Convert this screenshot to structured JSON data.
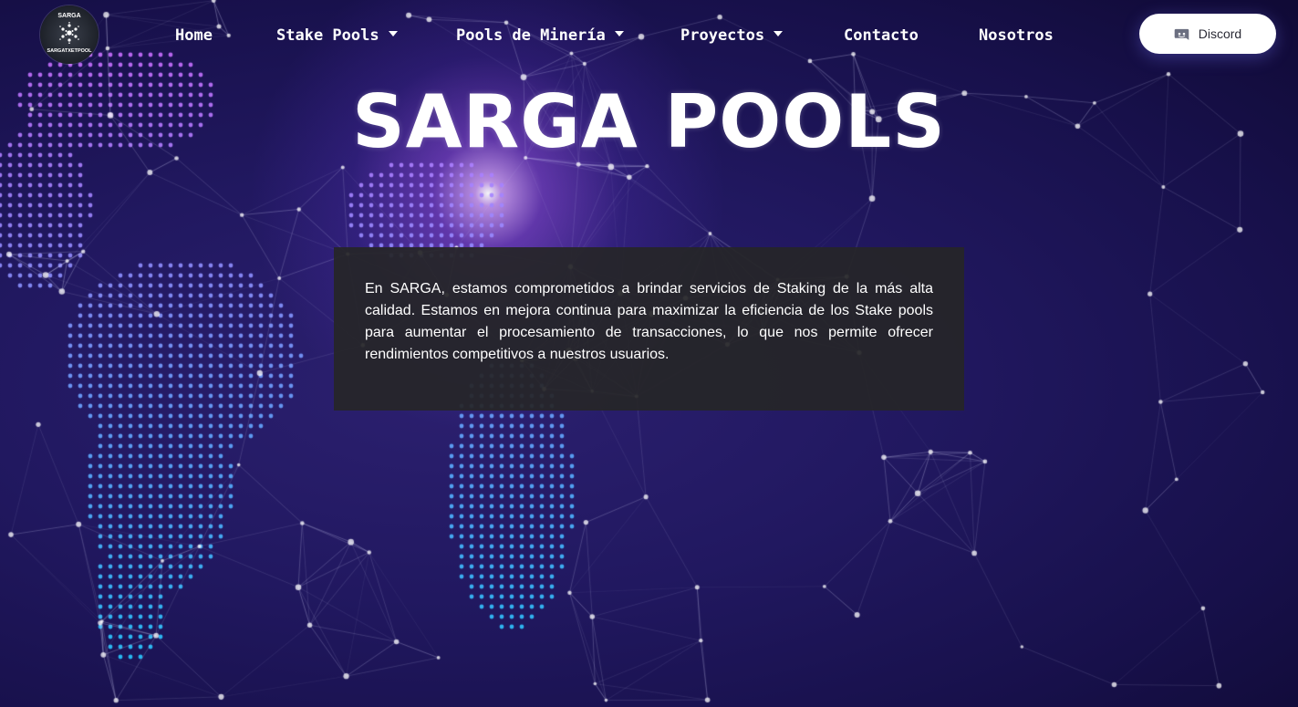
{
  "brand": {
    "logo_top_text": "SARGA",
    "logo_bottom_text": "SARGATXETPOOL"
  },
  "nav": {
    "items": [
      {
        "label": "Home"
      },
      {
        "label": "Stake Pools"
      },
      {
        "label": "Pools de Minería"
      },
      {
        "label": "Proyectos"
      },
      {
        "label": "Contacto"
      },
      {
        "label": "Nosotros"
      }
    ],
    "discord_label": "Discord",
    "discord_icon": "discord-icon"
  },
  "hero": {
    "title": "SARGA POOLS",
    "description": "En SARGA, estamos comprometidos a brindar servicios de Staking de la más alta calidad. Estamos en mejora continua para maximizar la eficiencia de los Stake pools para aumentar el procesamiento de transacciones, lo que nos permite ofrecer rendimientos competitivos a nuestros usuarios."
  },
  "colors": {
    "background": "#1c1553",
    "card_background": "#262628",
    "button_background": "#ffffff",
    "text": "#ffffff"
  }
}
